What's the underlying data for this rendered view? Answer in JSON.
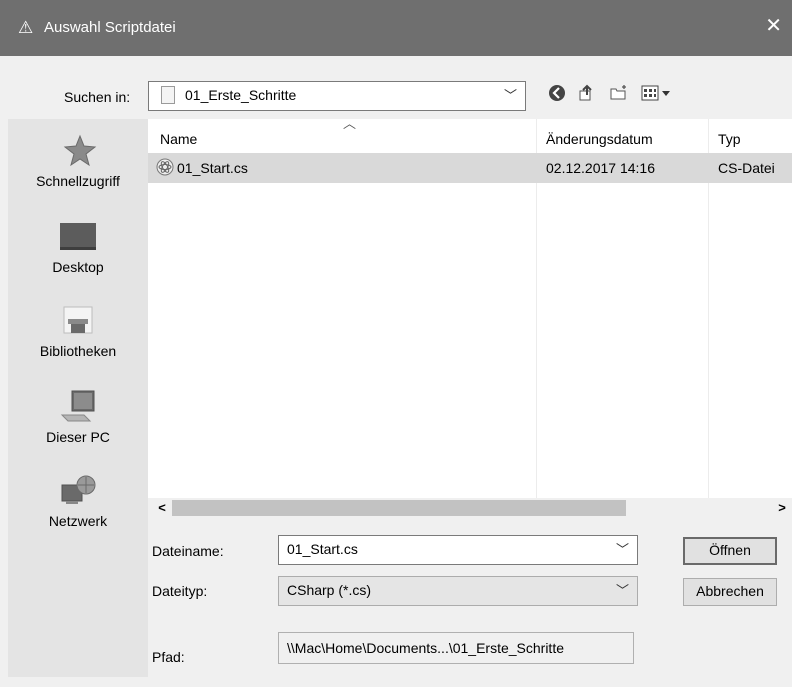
{
  "window": {
    "title": "Auswahl Scriptdatei"
  },
  "lookin": {
    "label": "Suchen in:",
    "value": "01_Erste_Schritte"
  },
  "toolbar": {
    "icons": [
      "back-icon",
      "up-folder-icon",
      "new-folder-icon",
      "view-menu-icon"
    ]
  },
  "places": [
    {
      "label": "Schnellzugriff",
      "icon": "quick-access-icon"
    },
    {
      "label": "Desktop",
      "icon": "desktop-icon"
    },
    {
      "label": "Bibliotheken",
      "icon": "libraries-icon"
    },
    {
      "label": "Dieser PC",
      "icon": "this-pc-icon"
    },
    {
      "label": "Netzwerk",
      "icon": "network-icon"
    }
  ],
  "list": {
    "columns": [
      "Name",
      "Änderungsdatum",
      "Typ"
    ],
    "rows": [
      {
        "name": "01_Start.cs",
        "date": "02.12.2017 14:16",
        "type": "CS-Datei",
        "icon": "csharp-file-icon"
      }
    ]
  },
  "scroll": {
    "left": "<",
    "right": ">"
  },
  "filename": {
    "label": "Dateiname:",
    "value": "01_Start.cs"
  },
  "filetype": {
    "label": "Dateityp:",
    "value": "CSharp (*.cs)"
  },
  "buttons": {
    "open": "Öffnen",
    "cancel": "Abbrechen"
  },
  "path": {
    "label": "Pfad:",
    "value": "\\\\Mac\\Home\\Documents...\\01_Erste_Schritte"
  },
  "colors": {
    "titlebar": "#6f6f6f",
    "selection": "#d9d9d9",
    "sidebar": "#e4e4e4"
  }
}
